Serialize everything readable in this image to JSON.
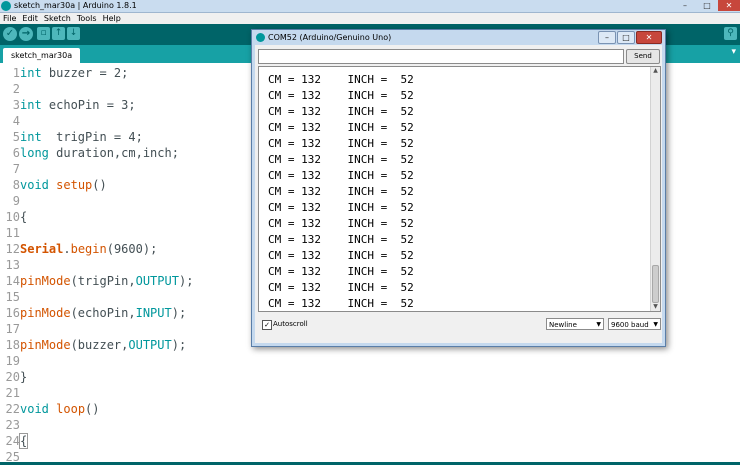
{
  "app": {
    "title": "sketch_mar30a | Arduino 1.8.1",
    "min_glyph": "–",
    "max_glyph": "□",
    "close_glyph": "✕"
  },
  "menu": [
    "File",
    "Edit",
    "Sketch",
    "Tools",
    "Help"
  ],
  "toolbar": {
    "verify_glyph": "✓",
    "upload_glyph": "→",
    "new_glyph": "▫",
    "open_glyph": "↑",
    "save_glyph": "↓",
    "serial_glyph": "⚲",
    "icons": [
      "check-icon",
      "arrow-right-icon",
      "file-new-icon",
      "open-icon",
      "save-icon",
      "magnifier-icon"
    ]
  },
  "tab": {
    "label": "sketch_mar30a",
    "menu_glyph": "▾"
  },
  "editor": {
    "lines": [
      {
        "n": "1",
        "text": "int buzzer = 2;"
      },
      {
        "n": "2",
        "text": ""
      },
      {
        "n": "3",
        "text": "int echoPin = 3;"
      },
      {
        "n": "4",
        "text": ""
      },
      {
        "n": "5",
        "text": "int  trigPin = 4;"
      },
      {
        "n": "6",
        "text": "long duration,cm,inch;"
      },
      {
        "n": "7",
        "text": ""
      },
      {
        "n": "8",
        "text": "void setup()"
      },
      {
        "n": "9",
        "text": ""
      },
      {
        "n": "10",
        "text": "{"
      },
      {
        "n": "11",
        "text": ""
      },
      {
        "n": "12",
        "text": "Serial.begin(9600);"
      },
      {
        "n": "13",
        "text": ""
      },
      {
        "n": "14",
        "text": "pinMode(trigPin,OUTPUT);"
      },
      {
        "n": "15",
        "text": ""
      },
      {
        "n": "16",
        "text": "pinMode(echoPin,INPUT);"
      },
      {
        "n": "17",
        "text": ""
      },
      {
        "n": "18",
        "text": "pinMode(buzzer,OUTPUT);"
      },
      {
        "n": "19",
        "text": ""
      },
      {
        "n": "20",
        "text": "}"
      },
      {
        "n": "21",
        "text": ""
      },
      {
        "n": "22",
        "text": "void loop()"
      },
      {
        "n": "23",
        "text": ""
      },
      {
        "n": "24",
        "text": "{"
      },
      {
        "n": "25",
        "text": ""
      }
    ]
  },
  "serial": {
    "title": "COM52 (Arduino/Genuino Uno)",
    "input_value": "",
    "send_label": "Send",
    "rows": [
      "CM = 132    INCH =  52",
      "CM = 132    INCH =  52",
      "CM = 132    INCH =  52",
      "CM = 132    INCH =  52",
      "CM = 132    INCH =  52",
      "CM = 132    INCH =  52",
      "CM = 132    INCH =  52",
      "CM = 132    INCH =  52",
      "CM = 132    INCH =  52",
      "CM = 132    INCH =  52",
      "CM = 132    INCH =  52",
      "CM = 132    INCH =  52",
      "CM = 132    INCH =  52",
      "CM = 132    INCH =  52",
      "CM = 132    INCH =  52"
    ],
    "autoscroll_label": "Autoscroll",
    "autoscroll_checked": true,
    "check_glyph": "✓",
    "line_ending": "Newline",
    "baud": "9600 baud",
    "caret_glyph": "▼",
    "scroll_up_glyph": "▲",
    "scroll_down_glyph": "▼"
  },
  "colors": {
    "teal_dark": "#006468",
    "teal_tab": "#17a1a5",
    "keyword": "#00979c",
    "function": "#d35400"
  }
}
